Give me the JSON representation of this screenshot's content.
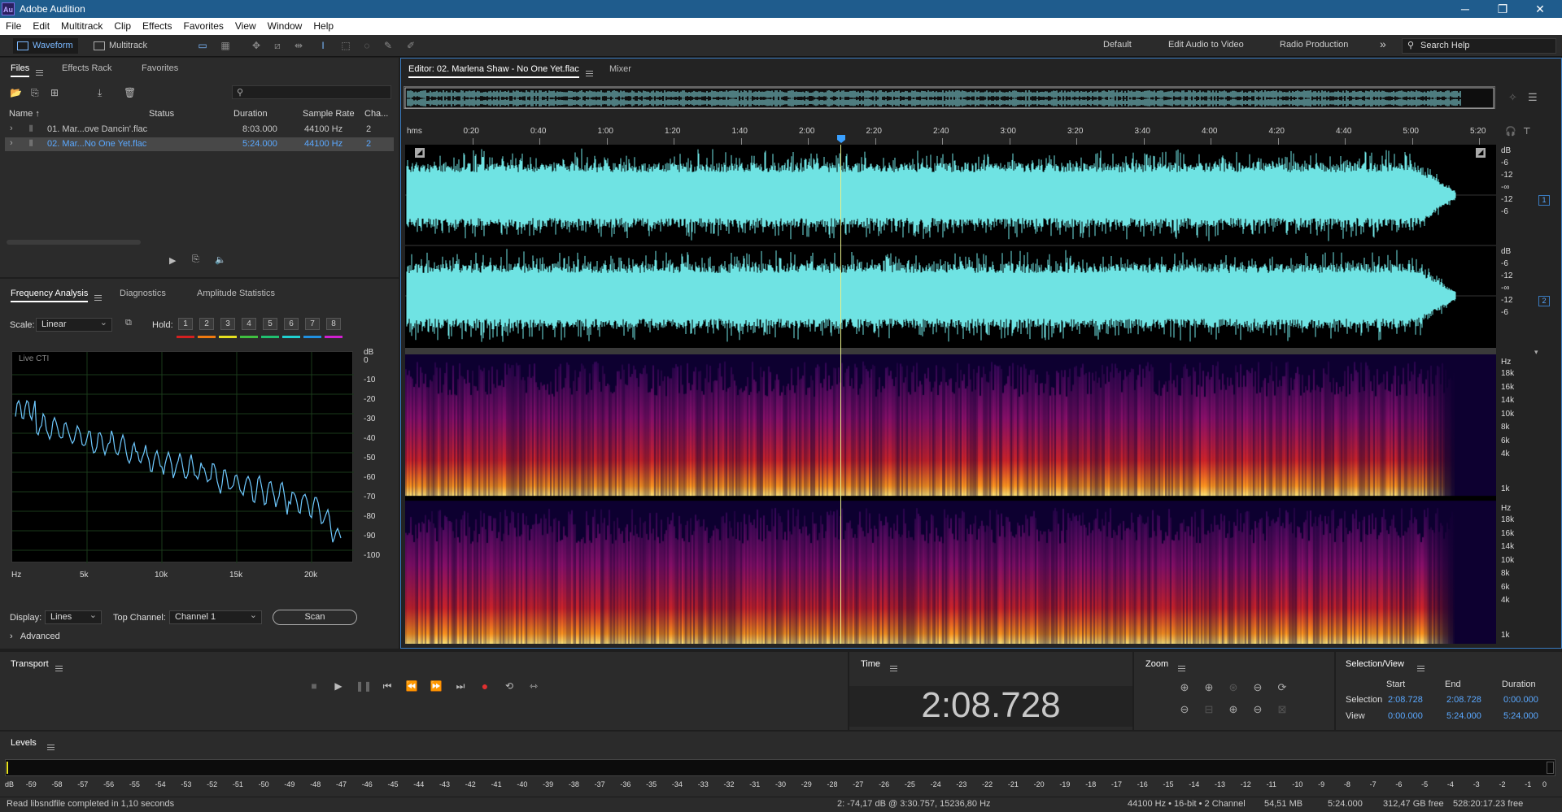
{
  "app": {
    "logo": "Au",
    "title": "Adobe Audition"
  },
  "window_controls": [
    "─",
    "❐",
    "✕"
  ],
  "menu": [
    "File",
    "Edit",
    "Multitrack",
    "Clip",
    "Effects",
    "Favorites",
    "View",
    "Window",
    "Help"
  ],
  "toolbar": {
    "waveform_label": "Waveform",
    "multitrack_label": "Multitrack",
    "workspaces": [
      "Default",
      "Edit Audio to Video",
      "Radio Production"
    ],
    "more": "»",
    "search_help": "Search Help"
  },
  "files_panel": {
    "tabs": [
      "Files",
      "Effects Rack",
      "Favorites"
    ],
    "columns": [
      "Name ↑",
      "Status",
      "Duration",
      "Sample Rate",
      "Cha..."
    ],
    "rows": [
      {
        "name": "01. Mar...ove Dancin'.flac",
        "status": "",
        "duration": "8:03.000",
        "rate": "44100 Hz",
        "ch": "2",
        "selected": false
      },
      {
        "name": "02. Mar...No One Yet.flac",
        "status": "",
        "duration": "5:24.000",
        "rate": "44100 Hz",
        "ch": "2",
        "selected": true
      }
    ]
  },
  "freq_panel": {
    "tabs": [
      "Frequency Analysis",
      "Diagnostics",
      "Amplitude Statistics"
    ],
    "scale_label": "Scale:",
    "scale_value": "Linear",
    "hold_label": "Hold:",
    "hold_buttons": [
      "1",
      "2",
      "3",
      "4",
      "5",
      "6",
      "7",
      "8"
    ],
    "hold_colors": [
      "#d42020",
      "#f07a10",
      "#e6e020",
      "#40c040",
      "#20c070",
      "#20d0d0",
      "#2090e0",
      "#d020d0"
    ],
    "graph_label": "Live CTI",
    "db_ticks": [
      "dB",
      "0",
      "-10",
      "-20",
      "-30",
      "-40",
      "-50",
      "-60",
      "-70",
      "-80",
      "-90",
      "-100"
    ],
    "hz_ticks": [
      "Hz",
      "5k",
      "10k",
      "15k",
      "20k"
    ],
    "display_label": "Display:",
    "display_value": "Lines",
    "top_channel_label": "Top Channel:",
    "top_channel_value": "Channel 1",
    "scan_label": "Scan",
    "advanced_label": "Advanced"
  },
  "editor": {
    "tab_label": "Editor: 02. Marlena Shaw - No One Yet.flac",
    "mixer_label": "Mixer",
    "ruler": [
      "hms",
      "0:20",
      "0:40",
      "1:00",
      "1:20",
      "1:40",
      "2:00",
      "2:20",
      "2:40",
      "3:00",
      "3:20",
      "3:40",
      "4:00",
      "4:20",
      "4:40",
      "5:00",
      "5:20"
    ],
    "wave_db_ticks": [
      "dB",
      "-6",
      "-12",
      "-∞",
      "-12",
      "-6"
    ],
    "channel_labels": [
      "1",
      "2"
    ],
    "spec_hz_ticks": [
      "Hz",
      "18k",
      "16k",
      "14k",
      "10k",
      "8k",
      "6k",
      "4k",
      "1k"
    ],
    "wave_color": "#6fe3e3",
    "playhead_fraction": 0.4
  },
  "transport": {
    "title": "Transport"
  },
  "time_panel": {
    "title": "Time",
    "value": "2:08.728"
  },
  "zoom_panel": {
    "title": "Zoom"
  },
  "selection_view": {
    "title": "Selection/View",
    "headers": [
      "Start",
      "End",
      "Duration"
    ],
    "selection_label": "Selection",
    "selection": [
      "2:08.728",
      "2:08.728",
      "0:00.000"
    ],
    "view_label": "View",
    "view": [
      "0:00.000",
      "5:24.000",
      "5:24.000"
    ]
  },
  "levels": {
    "title": "Levels",
    "ticks": [
      "dB",
      "-59",
      "-58",
      "-57",
      "-56",
      "-55",
      "-54",
      "-53",
      "-52",
      "-51",
      "-50",
      "-49",
      "-48",
      "-47",
      "-46",
      "-45",
      "-44",
      "-43",
      "-42",
      "-41",
      "-40",
      "-39",
      "-38",
      "-37",
      "-36",
      "-35",
      "-34",
      "-33",
      "-32",
      "-31",
      "-30",
      "-29",
      "-28",
      "-27",
      "-26",
      "-25",
      "-24",
      "-23",
      "-22",
      "-21",
      "-20",
      "-19",
      "-18",
      "-17",
      "-16",
      "-15",
      "-14",
      "-13",
      "-12",
      "-11",
      "-10",
      "-9",
      "-8",
      "-7",
      "-6",
      "-5",
      "-4",
      "-3",
      "-2",
      "-1",
      "0"
    ]
  },
  "status": {
    "message": "Read libsndfile completed in 1,10 seconds",
    "cursor_info": "2: -74,17 dB @ 3:30.757, 15236,80 Hz",
    "format": "44100 Hz • 16-bit • 2 Channel",
    "size": "54,51 MB",
    "duration": "5:24.000",
    "free": "312,47 GB free",
    "free_time": "528:20:17.23 free"
  }
}
